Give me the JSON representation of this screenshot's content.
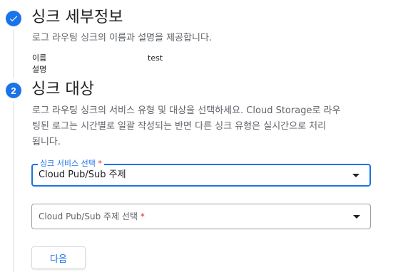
{
  "step1": {
    "title": "싱크 세부정보",
    "description": "로그 라우팅 싱크의 이름과 설명을 제공합니다.",
    "fields": [
      {
        "label": "이름",
        "value": "test"
      },
      {
        "label": "설명",
        "value": ""
      }
    ]
  },
  "step2": {
    "number": "2",
    "title": "싱크 대상",
    "description_lines": [
      "로그 라우팅 싱크의 서비스 유형 및 대상을 선택하세요. Cloud Storage로 라우",
      "팅된 로그는 시간별로 일괄 작성되는 반면 다른 싱크 유형은 실시간으로 처리",
      "됩니다."
    ],
    "service_select": {
      "label": "싱크 서비스 선택",
      "required_mark": "*",
      "value": "Cloud Pub/Sub 주제"
    },
    "topic_select": {
      "placeholder": "Cloud Pub/Sub 주제 선택",
      "required_mark": "*"
    },
    "next_button": "다음"
  },
  "colors": {
    "accent": "#1a73e8",
    "required": "#d93025",
    "text": "#202124",
    "secondary_text": "#5f6368",
    "divider": "#dadce0"
  },
  "icons": {
    "step1": "check-icon",
    "dropdown": "arrow-drop-down-icon"
  }
}
